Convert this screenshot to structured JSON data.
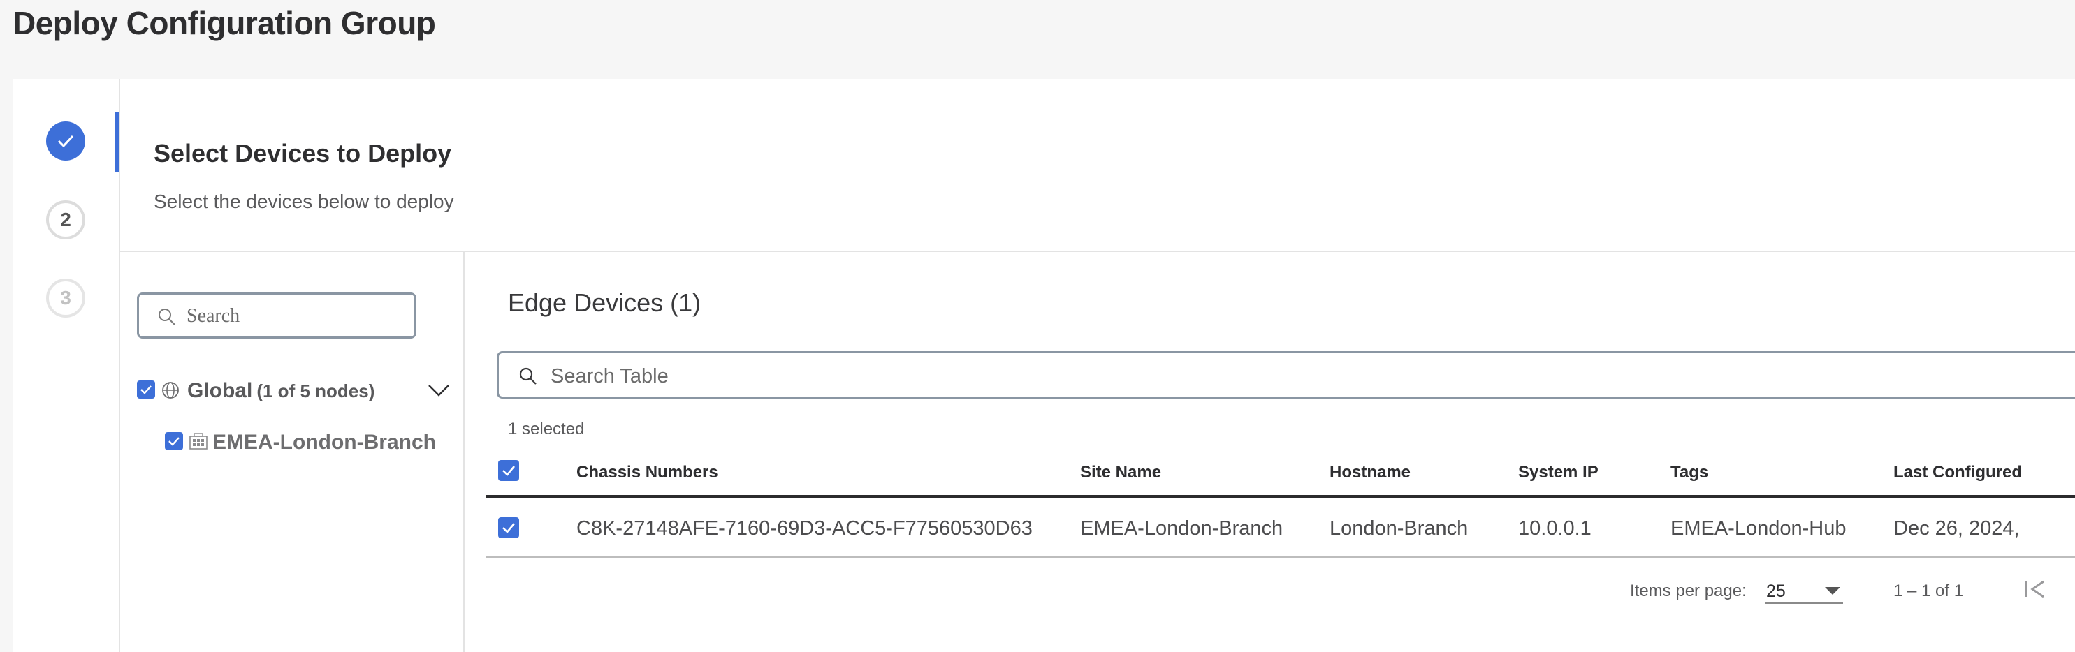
{
  "page": {
    "title": "Deploy Configuration Group"
  },
  "stepper": {
    "steps": [
      "",
      "2",
      "3"
    ]
  },
  "section": {
    "title": "Select Devices to Deploy",
    "subtitle": "Select the devices below to deploy"
  },
  "tree": {
    "search_placeholder": "Search",
    "root_label": "Global",
    "root_count": "(1 of 5 nodes)",
    "child_label": "EMEA-London-Branch"
  },
  "table": {
    "title": "Edge Devices (1)",
    "search_placeholder": "Search Table",
    "selected_text": "1 selected",
    "columns": [
      "Chassis Numbers",
      "Site Name",
      "Hostname",
      "System IP",
      "Tags",
      "Last Configured"
    ],
    "rows": [
      {
        "chassis": "C8K-27148AFE-7160-69D3-ACC5-F77560530D63",
        "site": "EMEA-London-Branch",
        "hostname": "London-Branch",
        "system_ip": "10.0.0.1",
        "tags": "EMEA-London-Hub",
        "last_configured": "Dec 26, 2024,"
      }
    ],
    "pagination": {
      "items_per_page_label": "Items per page:",
      "items_per_page": "25",
      "range": "1 – 1 of 1"
    }
  },
  "colors": {
    "accent": "#3d6fd8",
    "background": "#f6f6f6",
    "card": "#ffffff"
  },
  "icons": [
    "check-icon",
    "search-icon",
    "globe-icon",
    "building-icon",
    "chevron-down-icon",
    "first-page-icon",
    "caret-down-icon"
  ]
}
